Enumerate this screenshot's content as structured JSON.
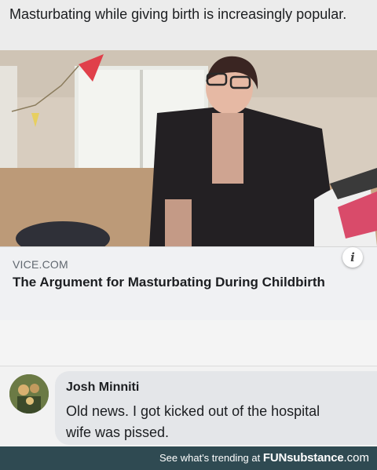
{
  "post": {
    "text": "Masturbating while giving birth is increasingly popular."
  },
  "link": {
    "domain": "VICE.COM",
    "title": "The Argument for Masturbating During Childbirth",
    "info_icon": "i"
  },
  "comment": {
    "author": "Josh Minniti",
    "text": "Old news. I got kicked out of the hospital\nwife was pissed."
  },
  "footer": {
    "tagline": "See what's trending at",
    "brand_main": "FUNsubstance",
    "brand_sub": ".com"
  }
}
